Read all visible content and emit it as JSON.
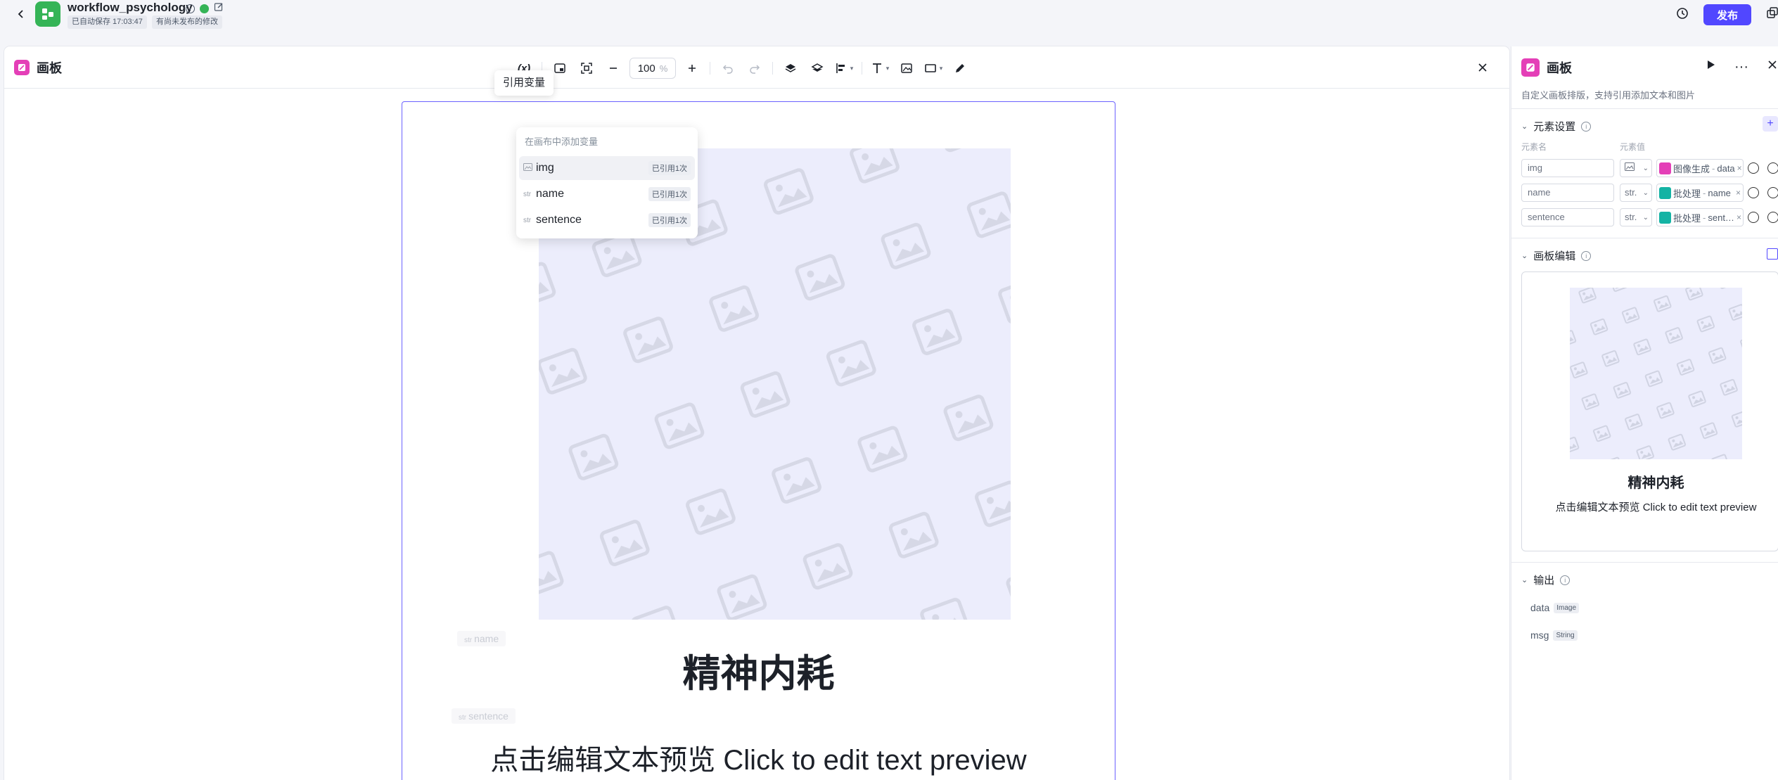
{
  "header": {
    "app_title": "workflow_psychology",
    "autosave_tag": "已自动保存 17:03:47",
    "unpublished_tag": "有尚未发布的修改",
    "publish_label": "发布"
  },
  "panel": {
    "title": "画板",
    "zoom_value": "100",
    "zoom_unit": "%",
    "tooltip": "引用变量"
  },
  "variable_dropdown": {
    "heading": "在画布中添加变量",
    "items": [
      {
        "type": "img",
        "label": "img",
        "badge": "已引用1次"
      },
      {
        "type": "str",
        "label": "name",
        "badge": "已引用1次"
      },
      {
        "type": "str",
        "label": "sentence",
        "badge": "已引用1次"
      }
    ]
  },
  "canvas": {
    "name_placeholder": "name",
    "sentence_placeholder": "sentence",
    "title_text": "精神内耗",
    "body_text": "点击编辑文本预览 Click to edit text preview"
  },
  "right_panel": {
    "title": "画板",
    "description": "自定义画板排版，支持引用添加文本和图片",
    "element_settings": {
      "title": "元素设置",
      "col_name": "元素名",
      "col_value": "元素值",
      "rows": [
        {
          "name": "img",
          "type": "",
          "source": "图像生成",
          "value": "data",
          "source_color": "#e43fb7"
        },
        {
          "name": "name",
          "type": "str.",
          "source": "批处理",
          "value": "name",
          "source_color": "#14b3a4"
        },
        {
          "name": "sentence",
          "type": "str.",
          "source": "批处理",
          "value": "sent…",
          "source_color": "#14b3a4"
        }
      ]
    },
    "canvas_edit": {
      "title": "画板编辑",
      "preview_title": "精神内耗",
      "preview_text": "点击编辑文本预览 Click to edit text preview"
    },
    "output": {
      "title": "输出",
      "items": [
        {
          "name": "data",
          "type": "Image"
        },
        {
          "name": "msg",
          "type": "String"
        }
      ]
    }
  },
  "colors": {
    "accent": "#5147ff",
    "app_logo": "#35b457",
    "panel_icon": "#e43fb7",
    "batch_source": "#14b3a4"
  }
}
